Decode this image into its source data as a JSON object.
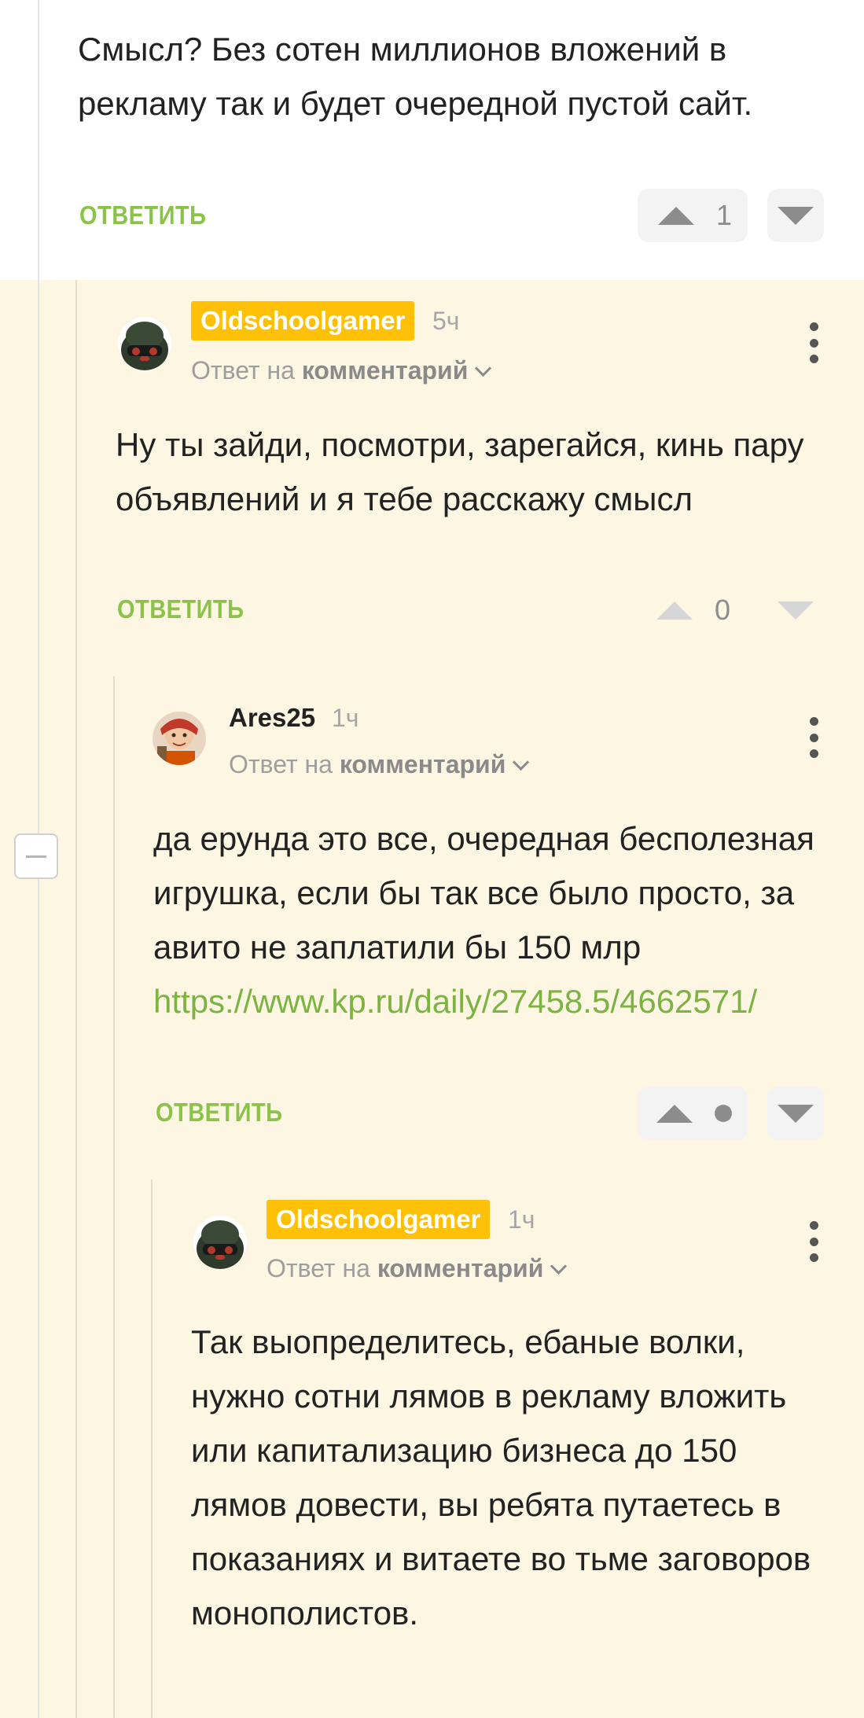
{
  "comments": [
    {
      "text": "Смысл? Без сотен миллионов вложений в рекламу так и будет очередной пустой сайт.",
      "reply_label": "ОТВЕТИТЬ",
      "votes": "1"
    },
    {
      "author": "Oldschoolgamer",
      "time": "5ч",
      "reply_prefix": "Ответ на",
      "reply_target": "комментарий",
      "text": "Ну ты зайди, посмотри, зарегайся, кинь пару объявлений и я тебе расскажу смысл",
      "reply_label": "ОТВЕТИТЬ",
      "votes": "0"
    },
    {
      "author": "Ares25",
      "time": "1ч",
      "reply_prefix": "Ответ на",
      "reply_target": "комментарий",
      "text": "да ерунда это все, очередная бесполезная игрушка, если бы так все было просто, за авито не заплатили бы 150 млр",
      "link": "https://www.kp.ru/daily/27458.5/4662571/",
      "reply_label": "ОТВЕТИТЬ"
    },
    {
      "author": "Oldschoolgamer",
      "time": "1ч",
      "reply_prefix": "Ответ на",
      "reply_target": "комментарий",
      "text": "Так выопределитесь, ебаные волки, нужно сотни лямов в рекламу вложить или капитализацию бизнеса до 150 лямов довести, вы ребята путаетесь в показаниях и витаете во тьме заговоров монополистов."
    }
  ],
  "colors": {
    "accent_green": "#8bc34a",
    "author_badge": "#ffc107",
    "thread_background": "#fcf6e2"
  },
  "icons": [
    "upvote-icon",
    "downvote-icon",
    "more-options-icon",
    "chevron-down-icon",
    "collapse-icon"
  ]
}
